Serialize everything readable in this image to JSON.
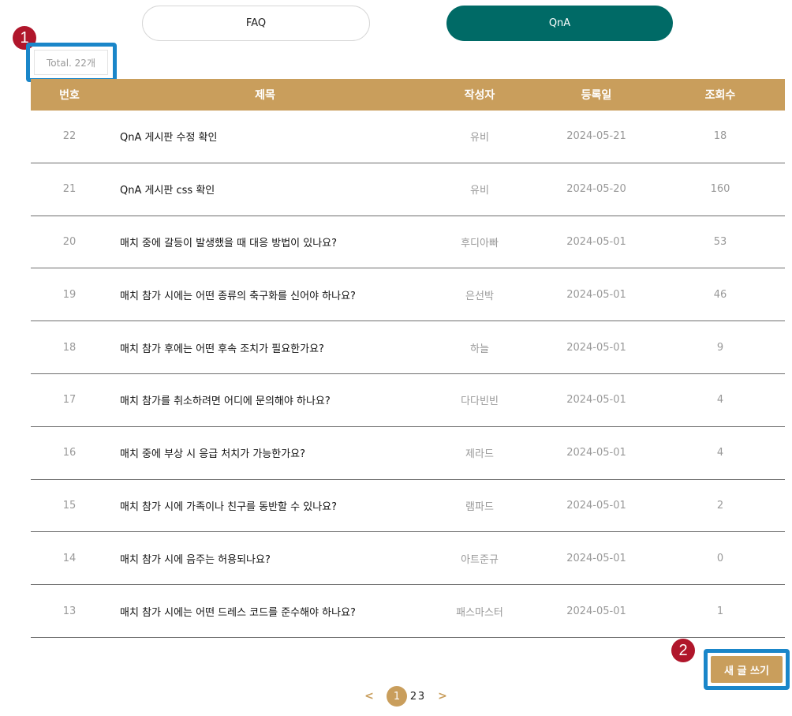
{
  "tabs": [
    {
      "label": "FAQ",
      "active": false
    },
    {
      "label": "QnA",
      "active": true
    }
  ],
  "annotations": {
    "badge1": "1",
    "badge2": "2"
  },
  "total_label": "Total. 22개",
  "table": {
    "headers": [
      "번호",
      "제목",
      "작성자",
      "등록일",
      "조회수"
    ],
    "rows": [
      {
        "num": "22",
        "title": "QnA 게시판 수정 확인",
        "author": "유비",
        "date": "2024-05-21",
        "views": "18"
      },
      {
        "num": "21",
        "title": "QnA 게시판 css 확인",
        "author": "유비",
        "date": "2024-05-20",
        "views": "160"
      },
      {
        "num": "20",
        "title": "매치 중에 갈등이 발생했을 때 대응 방법이 있나요?",
        "author": "후디아빠",
        "date": "2024-05-01",
        "views": "53"
      },
      {
        "num": "19",
        "title": "매치 참가 시에는 어떤 종류의 축구화를 신어야 하나요?",
        "author": "은선박",
        "date": "2024-05-01",
        "views": "46"
      },
      {
        "num": "18",
        "title": "매치 참가 후에는 어떤 후속 조치가 필요한가요?",
        "author": "하늘",
        "date": "2024-05-01",
        "views": "9"
      },
      {
        "num": "17",
        "title": "매치 참가를 취소하려면 어디에 문의해야 하나요?",
        "author": "다다빈빈",
        "date": "2024-05-01",
        "views": "4"
      },
      {
        "num": "16",
        "title": "매치 중에 부상 시 응급 처치가 가능한가요?",
        "author": "제라드",
        "date": "2024-05-01",
        "views": "4"
      },
      {
        "num": "15",
        "title": "매치 참가 시에 가족이나 친구를 동반할 수 있나요?",
        "author": "램파드",
        "date": "2024-05-01",
        "views": "2"
      },
      {
        "num": "14",
        "title": "매치 참가 시에 음주는 허용되나요?",
        "author": "아트준규",
        "date": "2024-05-01",
        "views": "0"
      },
      {
        "num": "13",
        "title": "매치 참가 시에는 어떤 드레스 코드를 준수해야 하나요?",
        "author": "패스마스터",
        "date": "2024-05-01",
        "views": "1"
      }
    ]
  },
  "write_button": "새 글 쓰기",
  "pagination": {
    "prev": "<",
    "pages": [
      "1",
      "2",
      "3"
    ],
    "current": "1",
    "next": ">"
  },
  "colors": {
    "accent_gold": "#c99e5c",
    "tab_active": "#006a66",
    "badge_red": "#b0162b",
    "highlight_blue": "#1a86c9"
  }
}
